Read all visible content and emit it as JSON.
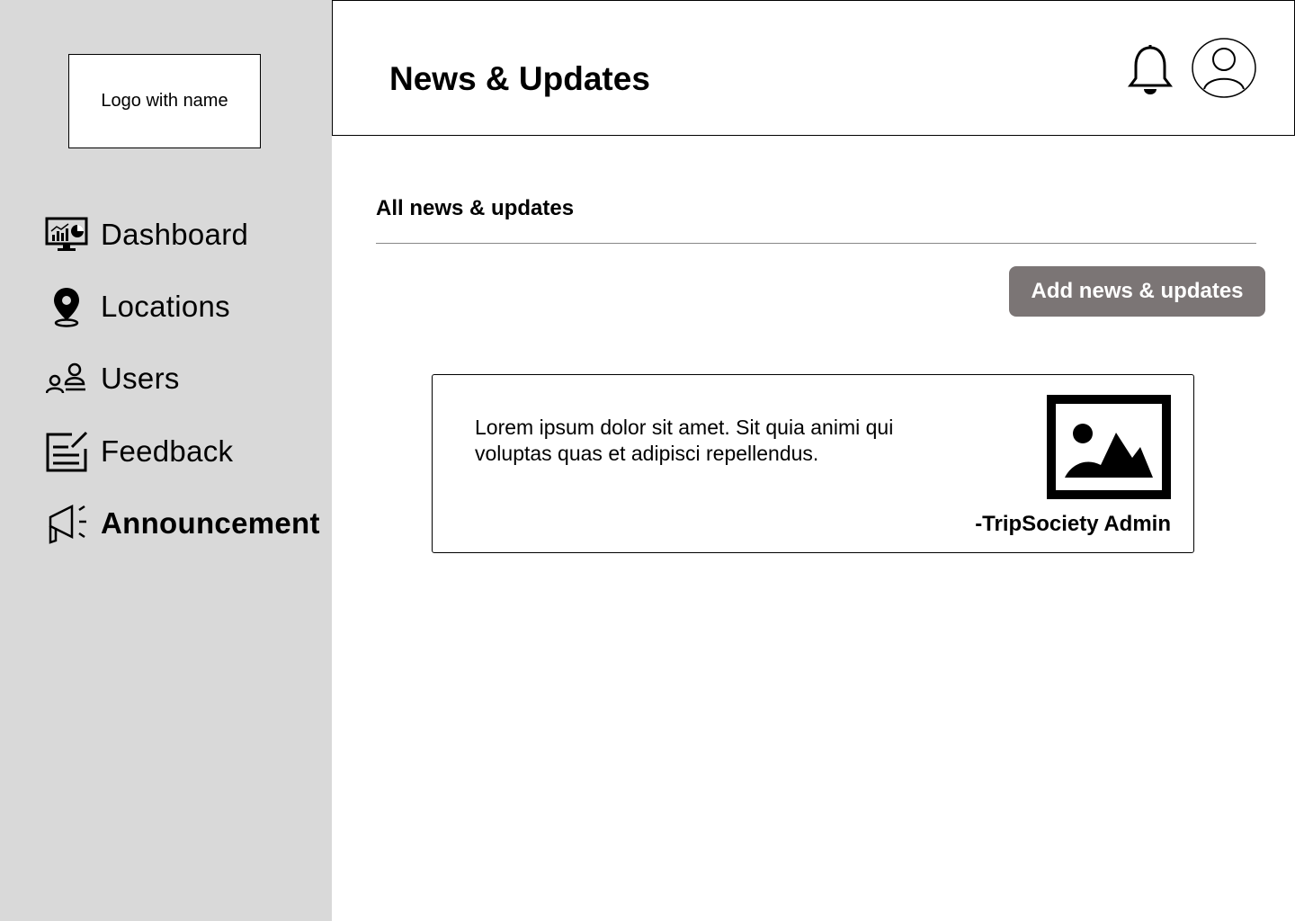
{
  "sidebar": {
    "logo_text": "Logo with name",
    "items": [
      {
        "label": "Dashboard",
        "icon": "dashboard-monitor-icon"
      },
      {
        "label": "Locations",
        "icon": "location-pin-icon"
      },
      {
        "label": "Users",
        "icon": "users-icon"
      },
      {
        "label": "Feedback",
        "icon": "feedback-edit-icon"
      },
      {
        "label": "Announcement",
        "icon": "megaphone-icon",
        "active": true
      }
    ]
  },
  "header": {
    "title": "News & Updates",
    "notification_icon": "bell-icon",
    "profile_icon": "user-avatar-icon"
  },
  "main": {
    "section_title": "All news & updates",
    "add_button_label": "Add news & updates",
    "posts": [
      {
        "text": "Lorem ipsum dolor sit amet. Sit quia animi qui voluptas quas et adipisci repellendus.",
        "author": "-TripSociety Admin",
        "image_icon": "image-placeholder-icon"
      }
    ]
  },
  "colors": {
    "sidebar_bg": "#d9d9d9",
    "button_bg": "#7b7575",
    "button_text": "#ffffff"
  }
}
